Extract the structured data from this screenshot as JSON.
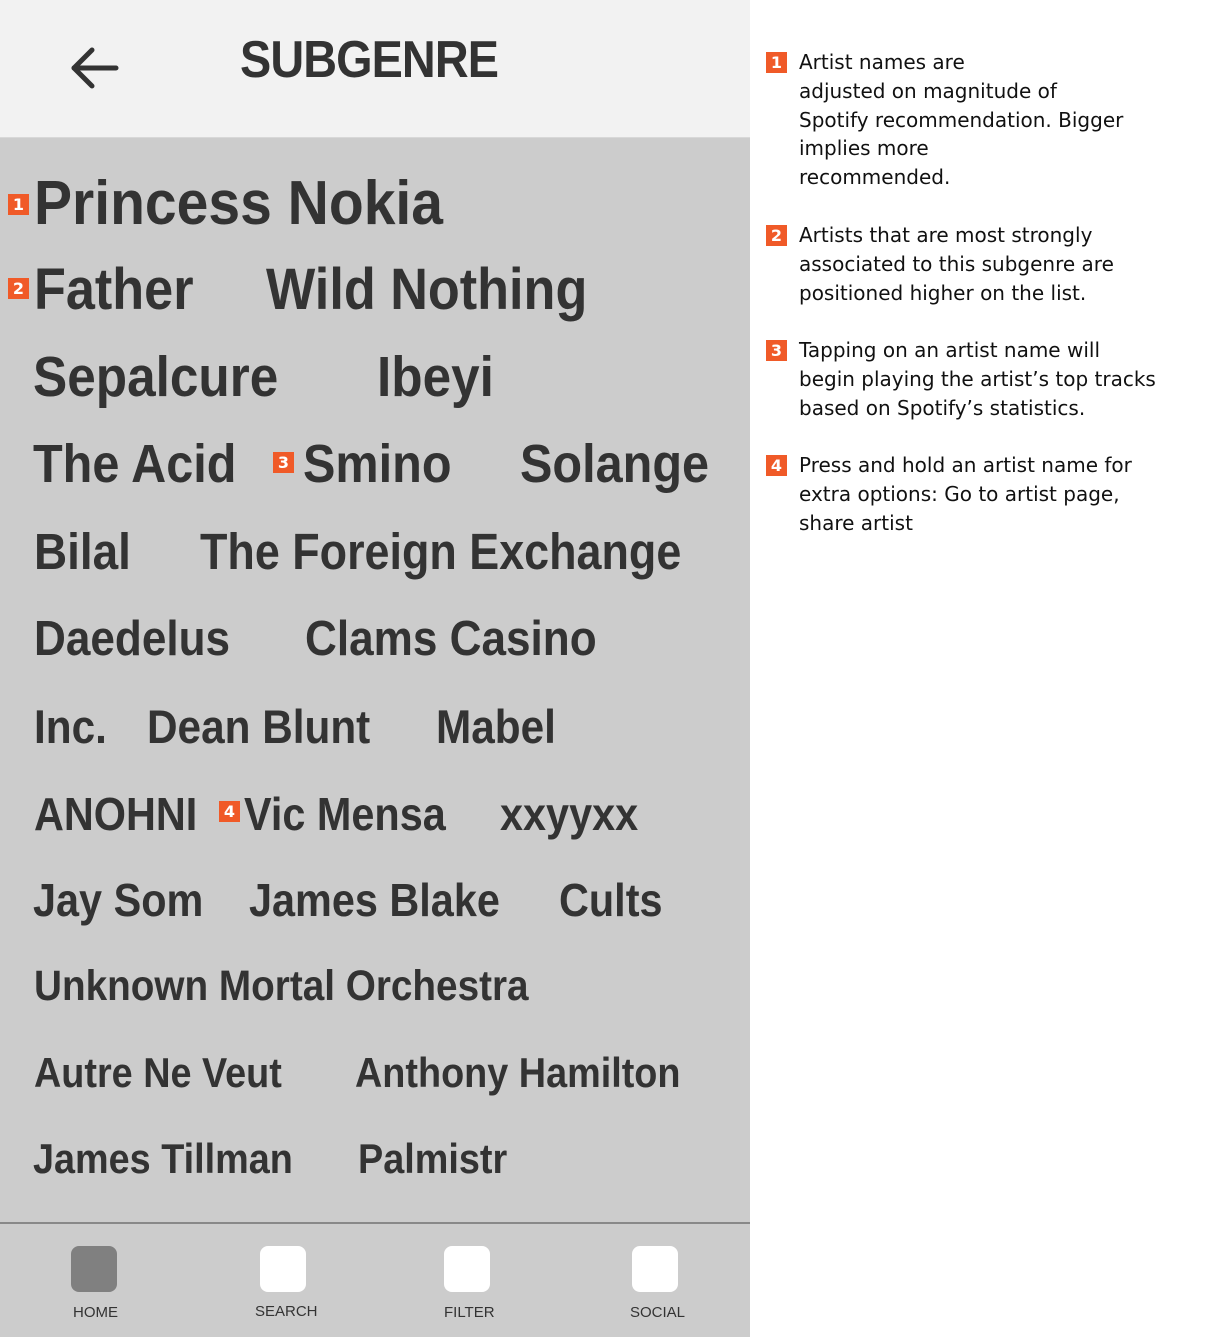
{
  "header": {
    "title": "SUBGENRE",
    "back_icon": "arrow-left-icon"
  },
  "artists": [
    "Princess Nokia",
    "Father",
    "Wild Nothing",
    "Sepalcure",
    "Ibeyi",
    "The Acid",
    "Smino",
    "Solange",
    "Bilal",
    "The Foreign Exchange",
    "Daedelus",
    "Clams Casino",
    "Inc.",
    "Dean Blunt",
    "Mabel",
    "ANOHNI",
    "Vic Mensa",
    "xxyyxx",
    "Jay Som",
    "James Blake",
    "Cults",
    "Unknown Mortal Orchestra",
    "Autre Ne Veut",
    "Anthony Hamilton",
    "James Tillman",
    "Palmistr"
  ],
  "badges": [
    "1",
    "2",
    "3",
    "4"
  ],
  "nav": {
    "items": [
      {
        "label": "HOME",
        "active": true
      },
      {
        "label": "SEARCH",
        "active": false
      },
      {
        "label": "FILTER",
        "active": false
      },
      {
        "label": "SOCIAL",
        "active": false
      }
    ]
  },
  "notes": [
    {
      "number": "1",
      "text": "Artist names are\nadjusted on magnitude of\nSpotify recommendation. Bigger\nimplies more\nrecommended."
    },
    {
      "number": "2",
      "text": "Artists that are most strongly\nassociated to this subgenre are\npositioned higher on the list."
    },
    {
      "number": "3",
      "text": "Tapping on an artist name will\nbegin playing the artist’s top tracks\nbased on Spotify’s statistics."
    },
    {
      "number": "4",
      "text": "Press and hold an artist name for\nextra options: Go to artist page,\nshare artist"
    }
  ],
  "colors": {
    "badge": "#f05a28",
    "panel": "#cccccc",
    "header": "#f2f2f2",
    "text": "#333333",
    "nav_active": "#808080"
  }
}
